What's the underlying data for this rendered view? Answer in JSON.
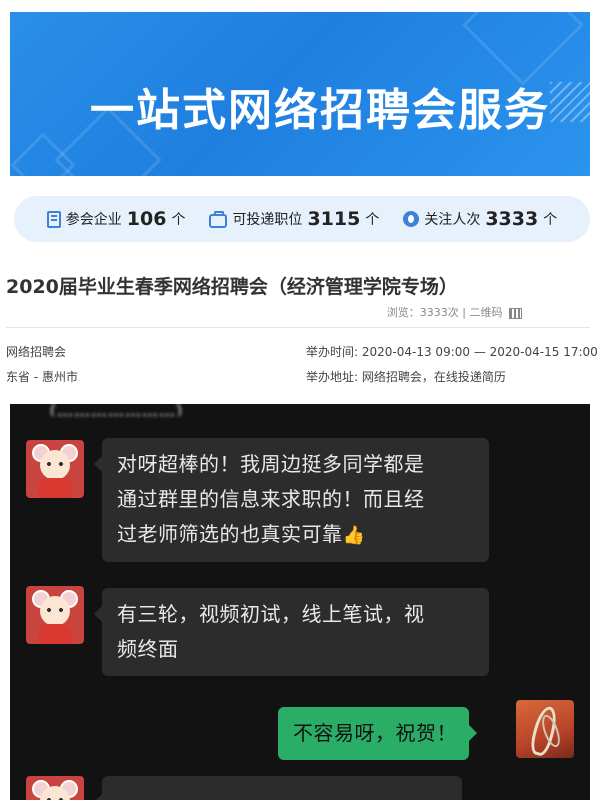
{
  "banner": {
    "title": "一站式网络招聘会服务"
  },
  "stats": {
    "companies": {
      "label": "参会企业",
      "value": "106",
      "unit": "个"
    },
    "positions": {
      "label": "可投递职位",
      "value": "3115",
      "unit": "个"
    },
    "followers": {
      "label": "关注人次",
      "value": "3333",
      "unit": "个"
    }
  },
  "event": {
    "title": "2020届毕业生春季网络招聘会（经济管理学院专场）",
    "views": "浏览：3333次 | 二维码",
    "type": "网络招聘会",
    "location": "东省 - 惠州市",
    "time_label": "举办时间:",
    "time_value": "2020-04-13 09:00 — 2020-04-15 17:00",
    "address_label": "举办地址:",
    "address_value": "网络招聘会，在线投递简历"
  },
  "chat": {
    "top_partial": "（…………………）",
    "messages": [
      {
        "from": "other",
        "lines": [
          "对呀超棒的！我周边挺多同学都是",
          "通过群里的信息来求职的！而且经",
          "过老师筛选的也真实可靠"
        ],
        "emoji": "👍"
      },
      {
        "from": "other",
        "lines": [
          "有三轮，视频初试，线上笔试，视",
          "频终面"
        ]
      },
      {
        "from": "me",
        "lines": [
          "不容易呀，祝贺！"
        ]
      }
    ]
  },
  "colors": {
    "banner": "#1f7fe0",
    "stats_bg": "#e7f1fb",
    "chat_bg": "#121212",
    "bubble_other": "#2c2c2c",
    "bubble_me": "#2aae67"
  }
}
